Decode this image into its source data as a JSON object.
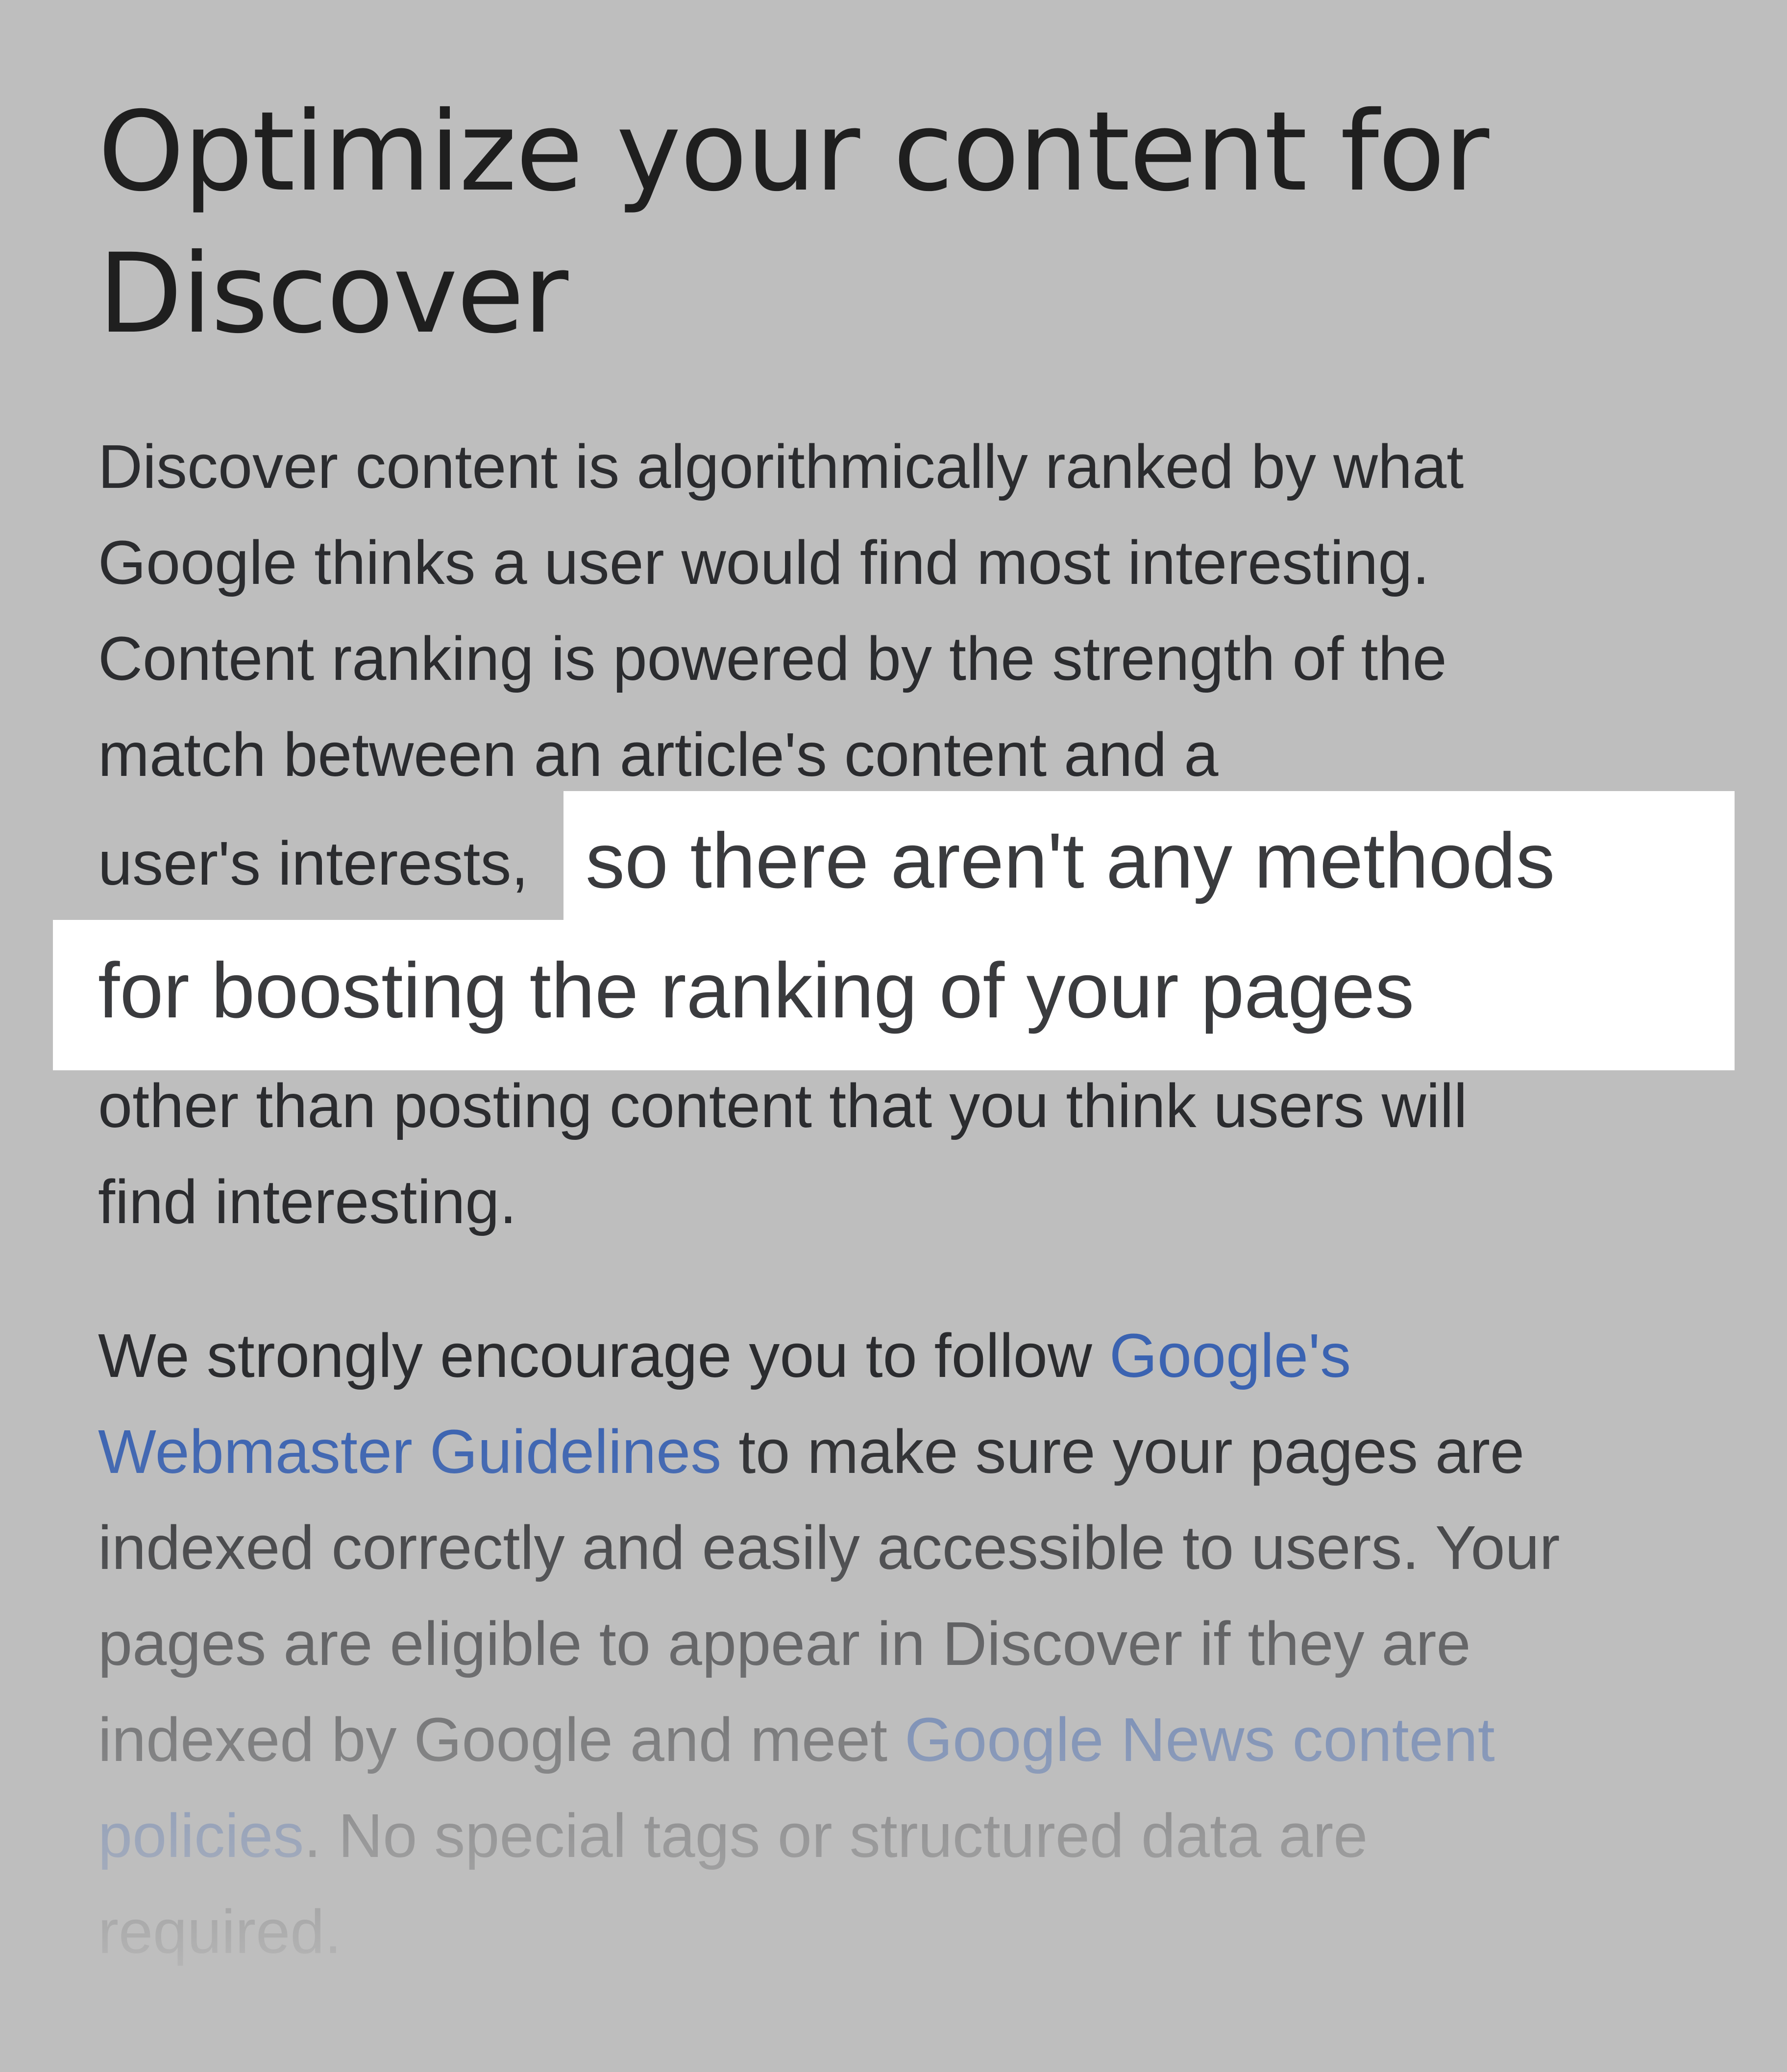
{
  "page": {
    "title_line1": "Optimize your content for",
    "title_line2": "Discover"
  },
  "paragraph1": {
    "line1": "Discover content is algorithmically ranked by what",
    "line2": "Google thinks a user would find most interesting.",
    "line3": "Content ranking is powered by the strength of the",
    "line4": "match between an article's content and a",
    "line5": "user's interests,",
    "highlight_line1": "so there aren't any methods",
    "highlight_line2": "for boosting the ranking of your pages",
    "line6": "other than posting content that you think users will",
    "line7": "find interesting."
  },
  "paragraph2": {
    "line1_prefix": "We strongly encourage you to follow ",
    "link1_part1": "Google's",
    "link1_part2": "Webmaster Guidelines",
    "line2_suffix": " to make sure your pages are",
    "line3": "indexed correctly and easily accessible to users. Your",
    "line4": "pages are eligible to appear in Discover if they are",
    "line5_prefix": "indexed by Google and meet ",
    "link2_part1": "Google News content",
    "link2_part2": "policies",
    "line6_suffix": ". No special tags or structured data are",
    "line7": "required."
  },
  "colors": {
    "background": "#bebebe",
    "highlight": "#ffffff",
    "link": "#3b63b1",
    "text": "#202124"
  }
}
